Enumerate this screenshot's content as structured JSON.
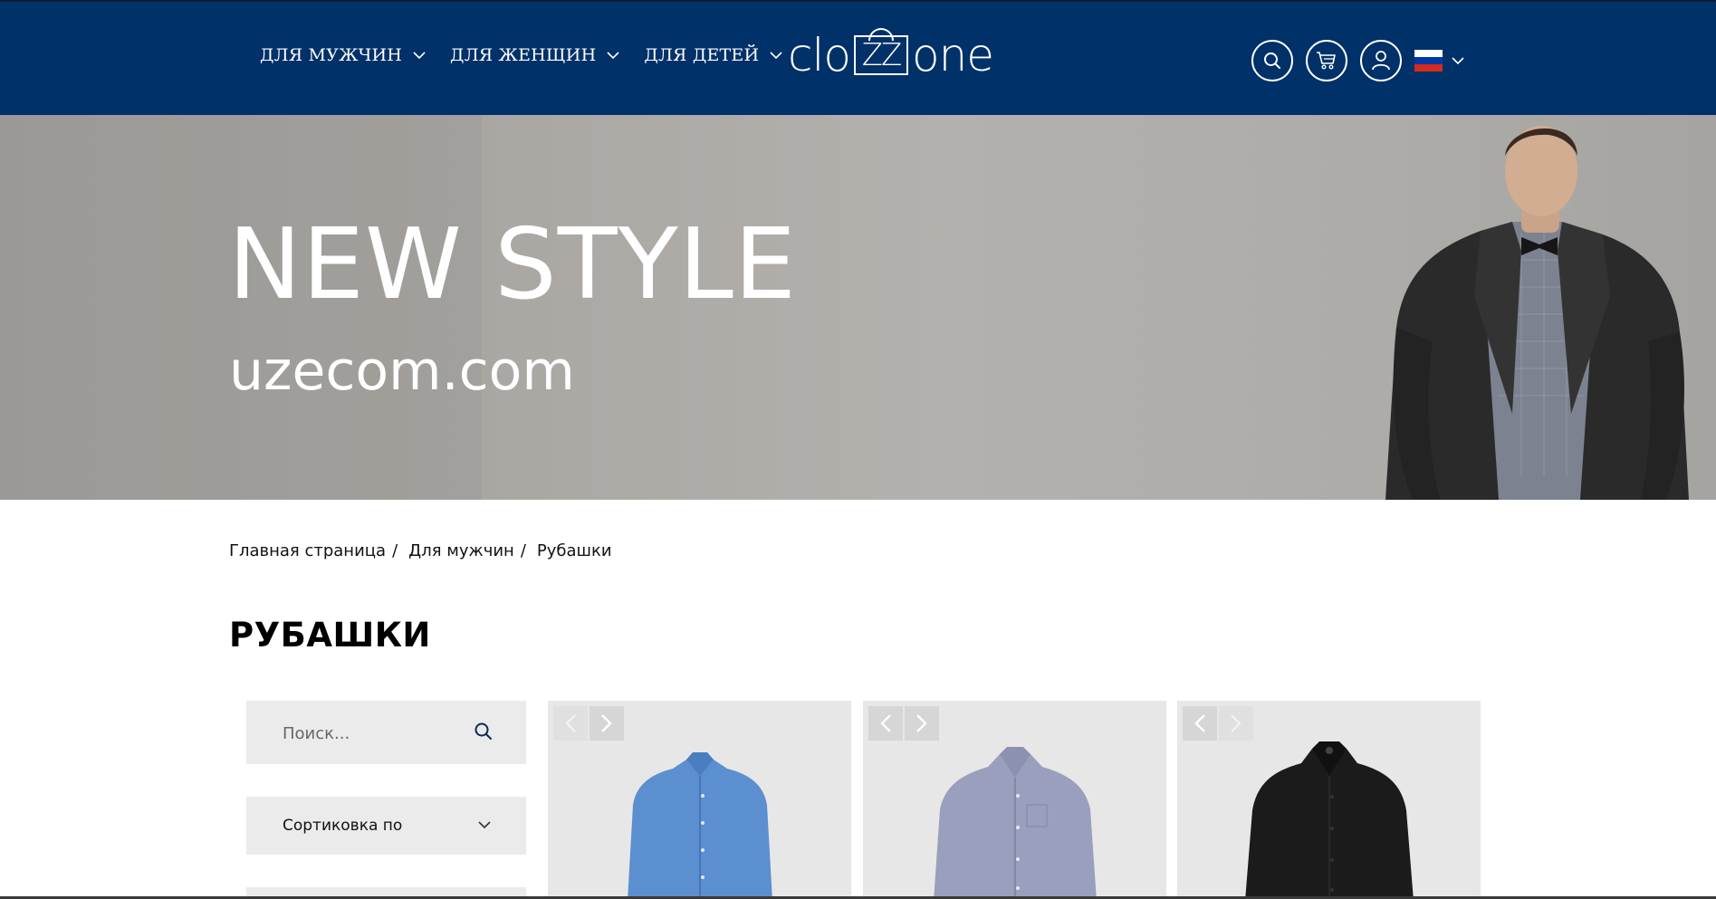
{
  "header": {
    "nav": [
      {
        "label": "ДЛЯ МУЖЧИН"
      },
      {
        "label": "ДЛЯ ЖЕНЩИН"
      },
      {
        "label": "ДЛЯ ДЕТЕЙ"
      }
    ],
    "logo": {
      "left": "clo",
      "middle": "ZZ",
      "right": "one"
    },
    "icons": [
      "search-icon",
      "cart-icon",
      "user-icon"
    ],
    "language": {
      "flag": "russia-flag-icon",
      "colors": [
        "#ffffff",
        "#0039a6",
        "#d52b1e"
      ]
    }
  },
  "banner": {
    "title": "NEW STYLE",
    "subtitle": "uzecom.com"
  },
  "breadcrumb": [
    {
      "label": "Главная страница",
      "sep": "/"
    },
    {
      "label": "Для мужчин",
      "sep": "/"
    },
    {
      "label": "Рубашки",
      "sep": ""
    }
  ],
  "page_title": "РУБАШКИ",
  "sidebar": {
    "search_placeholder": "Поиск...",
    "sort_label": "Сортиковка по"
  },
  "products": [
    {
      "color": "#5b8fd0",
      "image": "blue-shirt",
      "prev_enabled": false,
      "next_enabled": true
    },
    {
      "color": "#9a9fbd",
      "image": "grey-blue-shirt",
      "prev_enabled": true,
      "next_enabled": true
    },
    {
      "color": "#1b1b1b",
      "image": "black-shirt",
      "prev_enabled": true,
      "next_enabled": false
    }
  ],
  "colors": {
    "header_bg": "#003169",
    "banner_bg": "#aeaca8",
    "panel_bg": "#ebebeb"
  }
}
